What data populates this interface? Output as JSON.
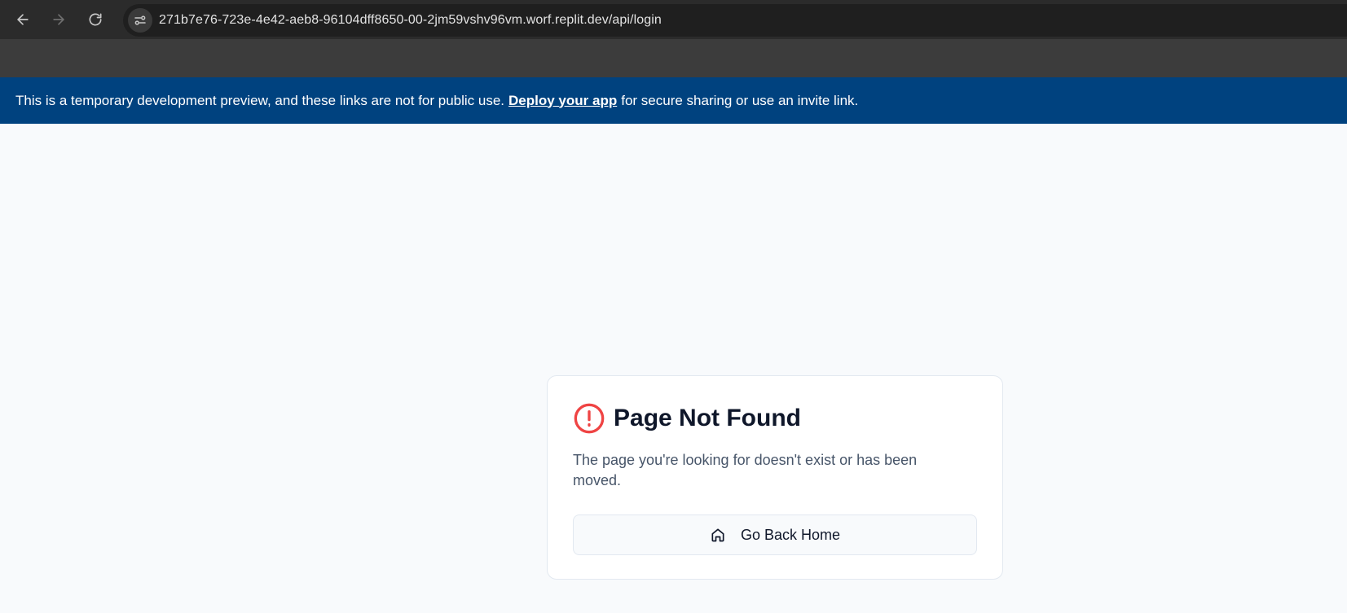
{
  "browser": {
    "url": "271b7e76-723e-4e42-aeb8-96104dff8650-00-2jm59vshv96vm.worf.replit.dev/api/login",
    "icons": {
      "back": "back-arrow-icon",
      "forward": "forward-arrow-icon",
      "reload": "reload-icon",
      "site_info": "site-settings-icon"
    }
  },
  "banner": {
    "text_before": "This is a temporary development preview, and these links are not for public use.",
    "link_text": "Deploy your app",
    "text_after": "for secure sharing or use an invite link.",
    "color": "#00427f"
  },
  "card": {
    "title": "Page Not Found",
    "description": "The page you're looking for doesn't exist or has been moved.",
    "button_label": "Go Back Home",
    "icons": {
      "alert": "alert-circle-icon",
      "home": "home-icon"
    },
    "alert_color": "#ef4444"
  }
}
